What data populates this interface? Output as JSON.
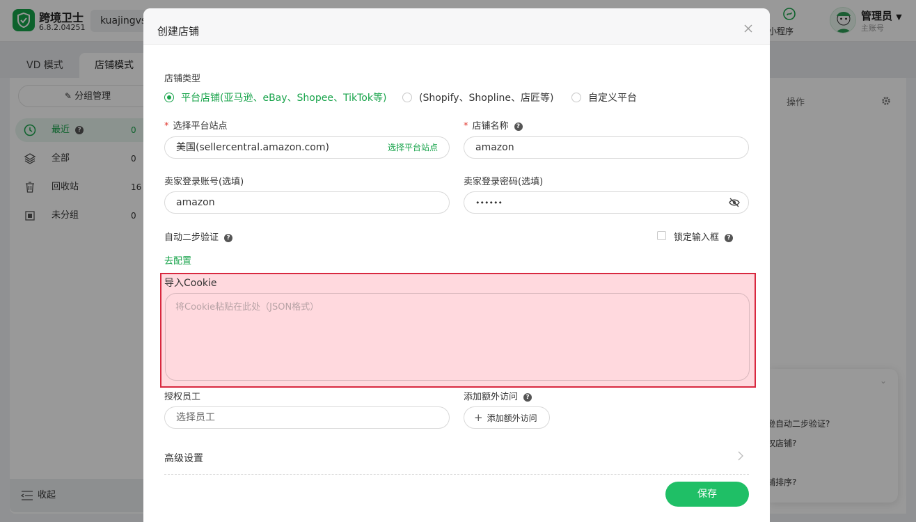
{
  "app": {
    "name": "跨境卫士",
    "version": "6.8.2.04251",
    "account": "kuajingvs",
    "mini_program_label": "小程序",
    "admin_name": "管理员",
    "admin_sub": "主账号"
  },
  "mode_tabs": [
    {
      "label": "VD 模式"
    },
    {
      "label": "店铺模式"
    }
  ],
  "sidebar": {
    "group_button": "分组管理",
    "items": [
      {
        "label": "最近",
        "count": "0"
      },
      {
        "label": "全部",
        "count": "0"
      },
      {
        "label": "回收站",
        "count": "16"
      },
      {
        "label": "未分组",
        "count": "0"
      }
    ],
    "collapse_label": "收起"
  },
  "right_panel": {
    "ops_label": "操作",
    "help_questions": [
      "逊自动二步验证?",
      "权店铺?",
      "铺排序?"
    ]
  },
  "modal": {
    "title": "创建店铺",
    "shop_type_label": "店铺类型",
    "shop_types": [
      {
        "label": "平台店铺(亚马逊、eBay、Shopee、TikTok等)",
        "selected": true
      },
      {
        "label": "(Shopify、Shopline、店匠等)",
        "selected": false
      },
      {
        "label": "自定义平台",
        "selected": false
      }
    ],
    "site": {
      "label": "选择平台站点",
      "value": "美国(sellercentral.amazon.com)",
      "suffix": "选择平台站点"
    },
    "shop_name": {
      "label": "店铺名称",
      "value": "amazon"
    },
    "seller_account": {
      "label": "卖家登录账号(选填)",
      "value": "amazon"
    },
    "seller_password": {
      "label": "卖家登录密码(选填)",
      "value": "••••••"
    },
    "two_step": {
      "label": "自动二步验证",
      "link": "去配置"
    },
    "lock_input": {
      "label": "锁定输入框"
    },
    "cookie": {
      "label": "导入Cookie",
      "placeholder": "将Cookie粘贴在此处（JSON格式）"
    },
    "staff": {
      "label": "授权员工",
      "placeholder": "选择员工"
    },
    "extra_access": {
      "label": "添加额外访问",
      "button": "添加额外访问"
    },
    "advanced": {
      "label": "高级设置"
    },
    "save_label": "保存"
  },
  "colors": {
    "brand_green": "#17a34a",
    "button_green": "#1fbf66",
    "highlight_red": "#d8283f"
  }
}
